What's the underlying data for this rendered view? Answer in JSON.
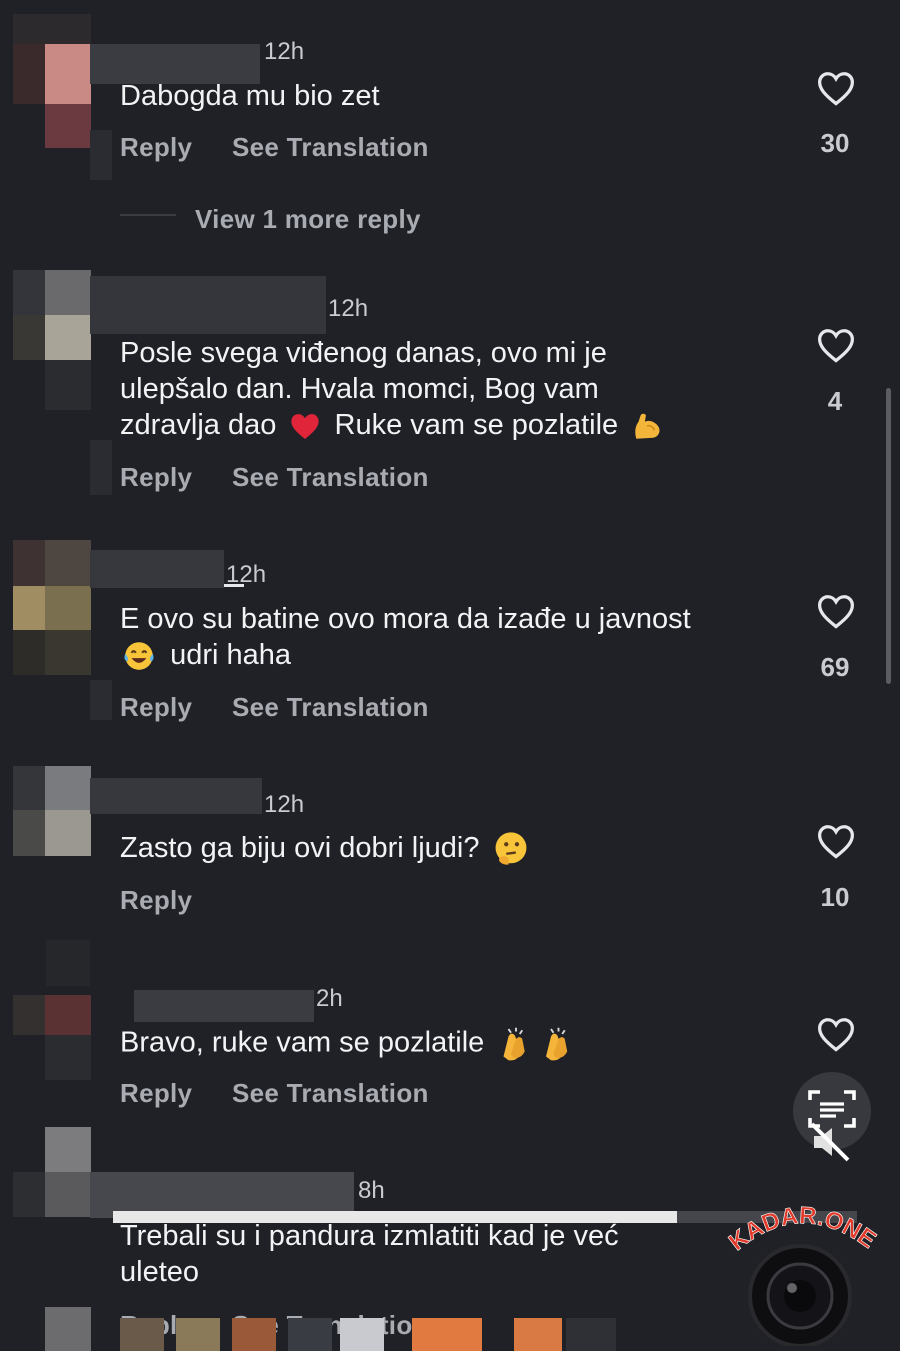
{
  "comments": [
    {
      "time": "12h",
      "lines": [
        "Dabogda mu bio zet"
      ],
      "reply": "Reply",
      "translate": "See Translation",
      "likes": "30",
      "view_more": "View 1 more reply"
    },
    {
      "time": "12h",
      "lines": [
        "Posle svega viđenog danas, ovo mi je",
        "ulepšalo dan. Hvala momci, Bog vam",
        "zdravlja dao",
        "Ruke vam se pozlatile"
      ],
      "reply": "Reply",
      "translate": "See Translation",
      "likes": "4"
    },
    {
      "time": "12h",
      "lines": [
        "E ovo su batine ovo mora da izađe u javnost",
        "udri haha"
      ],
      "reply": "Reply",
      "translate": "See Translation",
      "likes": "69"
    },
    {
      "time": "12h",
      "lines": [
        "Zasto ga biju ovi dobri ljudi?"
      ],
      "reply": "Reply",
      "likes": "10"
    },
    {
      "time": "2h",
      "lines": [
        "Bravo, ruke vam se pozlatile"
      ],
      "reply": "Reply",
      "translate": "See Translation"
    },
    {
      "time": "8h",
      "lines": [
        "Trebali su i pandura izmlatiti kad je već",
        "uleteo"
      ],
      "reply": "Reply",
      "translate": "See Translation"
    }
  ],
  "watermark": "KADAR.ONE",
  "colors": {
    "background": "#1f2126",
    "text": "#f2f3f5",
    "muted": "#a9abb2",
    "heart_red": "#e0243a"
  }
}
